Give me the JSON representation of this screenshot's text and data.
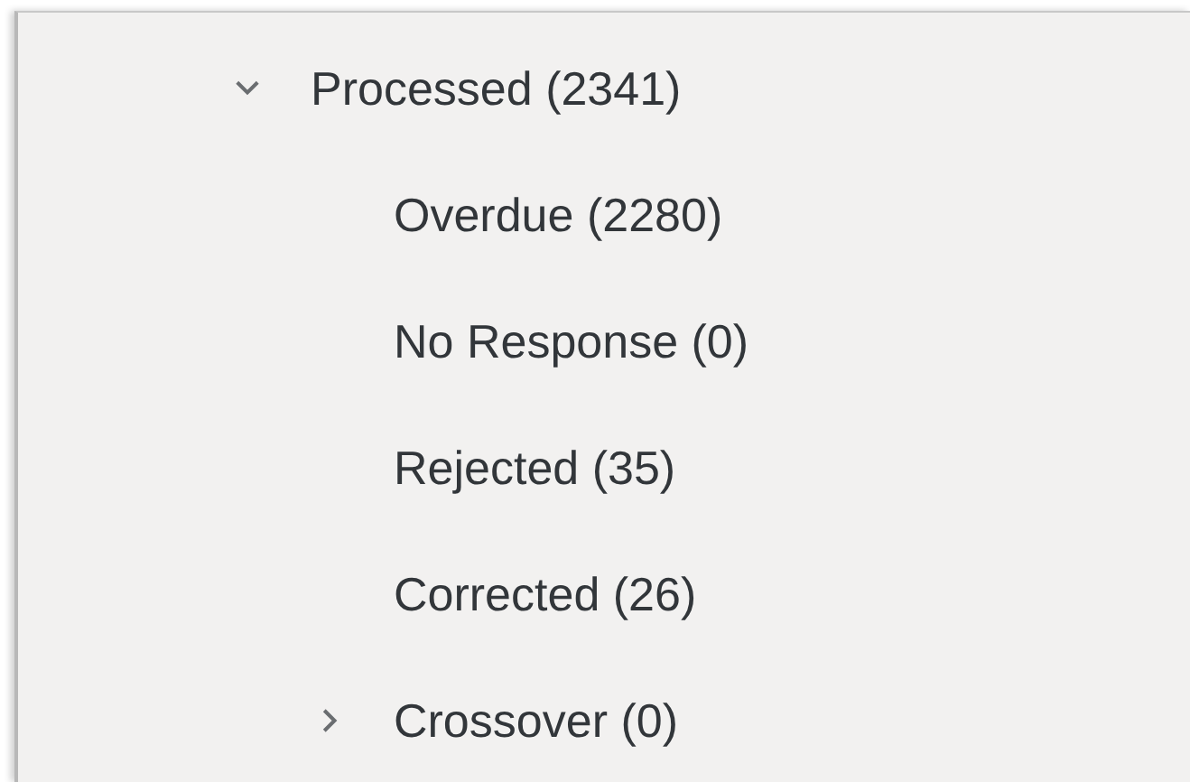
{
  "tree": [
    {
      "label": "Processed (2341)",
      "expanded": true,
      "children": [
        {
          "label": "Overdue (2280)"
        },
        {
          "label": "No Response (0)"
        },
        {
          "label": "Rejected (35)"
        },
        {
          "label": "Corrected (26)"
        },
        {
          "label": "Crossover (0)",
          "expanded": false
        }
      ]
    }
  ]
}
